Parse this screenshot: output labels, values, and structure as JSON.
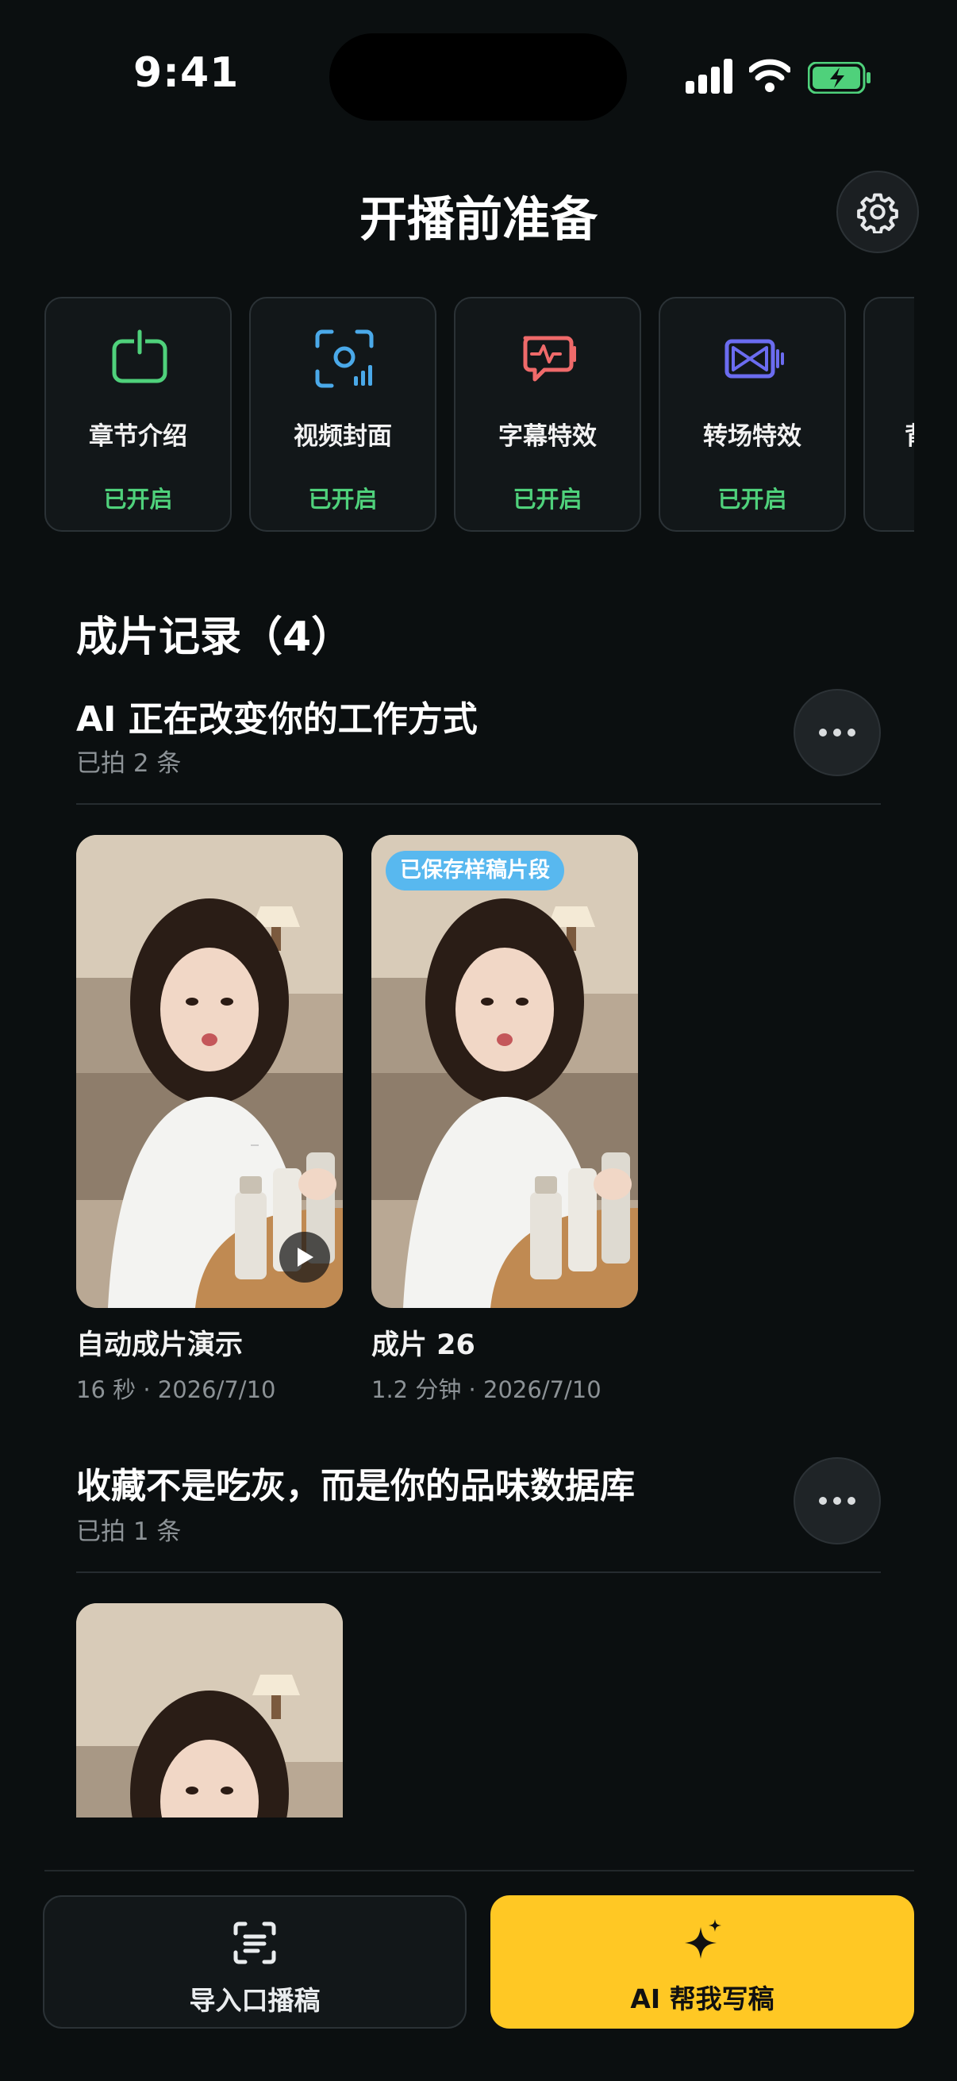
{
  "status_bar": {
    "time": "9:41"
  },
  "header": {
    "title": "开播前准备",
    "settings_icon": "gear-icon"
  },
  "features": [
    {
      "label": "章节介绍",
      "status": "已开启",
      "icon": "power-frame-icon",
      "color": "#4fd17b"
    },
    {
      "label": "视频封面",
      "status": "已开启",
      "icon": "camera-scan-icon",
      "color": "#4aa9e9"
    },
    {
      "label": "字幕特效",
      "status": "已开启",
      "icon": "subtitle-pulse-icon",
      "color": "#ef6a6a"
    },
    {
      "label": "转场特效",
      "status": "已开启",
      "icon": "transition-icon",
      "color": "#6b6cf0"
    },
    {
      "label": "背",
      "status": "",
      "icon": ""
    }
  ],
  "records": {
    "title": "成片记录（4）",
    "groups": [
      {
        "title": "AI 正在改变你的工作方式",
        "count_text": "已拍 2 条",
        "clips": [
          {
            "name": "自动成片演示",
            "meta": "16 秒 · 2026/7/10",
            "badge": ""
          },
          {
            "name": "成片 26",
            "meta": "1.2 分钟 · 2026/7/10",
            "badge": "已保存样稿片段"
          }
        ]
      },
      {
        "title": "收藏不是吃灰，而是你的品味数据库",
        "count_text": "已拍 1 条",
        "clips": []
      }
    ]
  },
  "bottom": {
    "import_label": "导入口播稿",
    "import_icon": "scan-text-icon",
    "ai_label": "AI 帮我写稿",
    "ai_icon": "sparkle-icon",
    "accent": "#ffc824"
  }
}
